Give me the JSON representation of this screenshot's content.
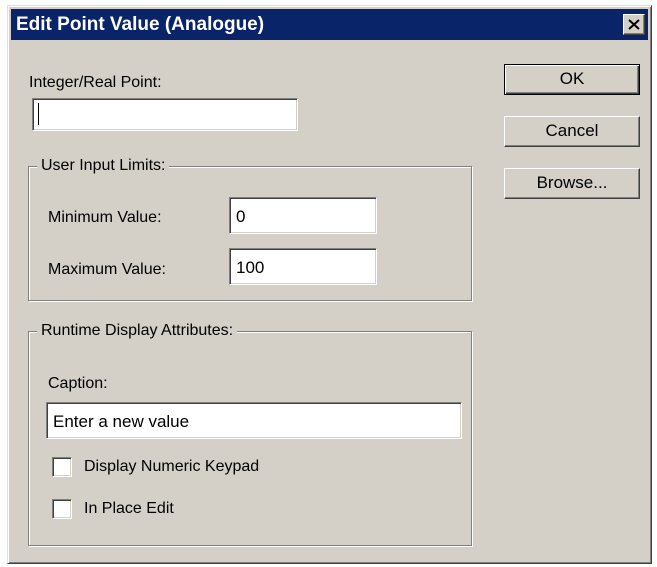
{
  "window": {
    "title": "Edit Point Value (Analogue)",
    "close_icon": "close-icon"
  },
  "point": {
    "label": "Integer/Real Point:",
    "value": ""
  },
  "limits": {
    "legend": "User Input Limits:",
    "min_label": "Minimum Value:",
    "min_value": "0",
    "max_label": "Maximum Value:",
    "max_value": "100"
  },
  "display": {
    "legend": "Runtime Display Attributes:",
    "caption_label": "Caption:",
    "caption_value": "Enter a new value",
    "keypad_label": "Display Numeric Keypad",
    "keypad_checked": false,
    "inplace_label": "In Place Edit",
    "inplace_checked": false
  },
  "buttons": {
    "ok": "OK",
    "cancel": "Cancel",
    "browse": "Browse..."
  },
  "colors": {
    "titlebar": "#0a246a",
    "face": "#d4d0c8"
  }
}
